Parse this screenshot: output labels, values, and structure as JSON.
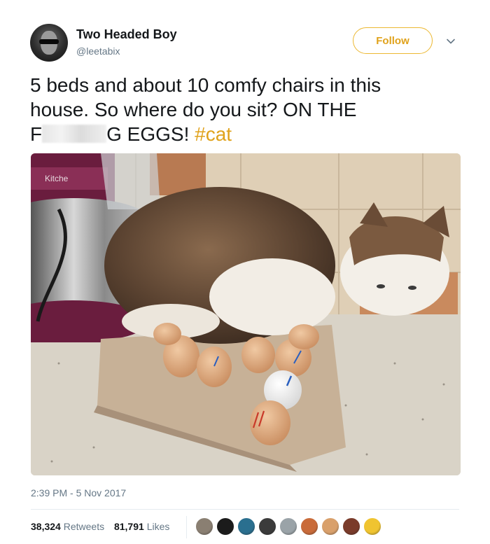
{
  "author": {
    "name": "Two Headed Boy",
    "handle": "@leetabix"
  },
  "follow_label": "Follow",
  "tweet": {
    "text_line1": "5 beds and about 10 comfy chairs in this",
    "text_line2": "house. So where do you sit? ON THE",
    "text_line3_start": "F",
    "text_line3_end": "G EGGS!",
    "hashtag": "#cat"
  },
  "photo": {
    "appliance_text": "Kitche"
  },
  "timestamp": "2:39 PM - 5 Nov 2017",
  "stats": {
    "retweets_count": "38,324",
    "retweets_label": "Retweets",
    "likes_count": "81,791",
    "likes_label": "Likes"
  },
  "liker_colors": [
    "#8a7f72",
    "#1b1b1b",
    "#2a6f8f",
    "#3b3b3b",
    "#9aa3a8",
    "#c96b3a",
    "#d9a06b",
    "#7a3b2a",
    "#f0c430"
  ],
  "colors": {
    "accent": "#e0a21b",
    "muted": "#657786",
    "text": "#14171a"
  }
}
